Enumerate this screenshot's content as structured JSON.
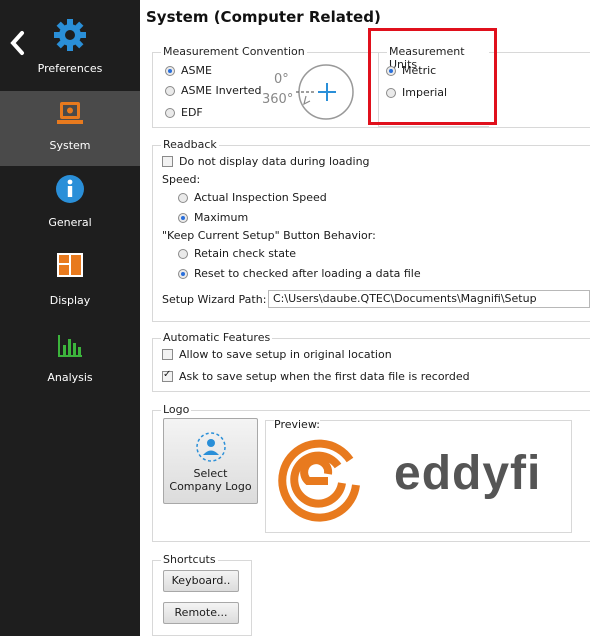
{
  "sidebar": {
    "items": [
      {
        "label": "Preferences",
        "icon": "gear-icon"
      },
      {
        "label": "System",
        "icon": "computer-icon"
      },
      {
        "label": "General",
        "icon": "info-icon"
      },
      {
        "label": "Display",
        "icon": "display-layout-icon"
      },
      {
        "label": "Analysis",
        "icon": "bar-chart-icon"
      }
    ]
  },
  "page_title": "System (Computer Related)",
  "measurement_convention": {
    "legend": "Measurement Convention",
    "options": [
      "ASME",
      "ASME Inverted",
      "EDF"
    ],
    "selected": "ASME",
    "diagram": {
      "zero": "0°",
      "three_sixty": "360°"
    }
  },
  "measurement_units": {
    "legend": "Measurement Units",
    "options": [
      "Metric",
      "Imperial"
    ],
    "selected": "Metric"
  },
  "readback": {
    "legend": "Readback",
    "no_display_label": "Do not display data during loading",
    "speed_label": "Speed:",
    "speed_options": [
      "Actual Inspection Speed",
      "Maximum"
    ],
    "speed_selected": "Maximum",
    "keep_label": "\"Keep Current Setup\" Button Behavior:",
    "keep_options": [
      "Retain check state",
      "Reset to checked after loading a data file"
    ],
    "keep_selected": "Reset to checked after loading a data file",
    "wizard_label": "Setup Wizard Path:",
    "wizard_path": "C:\\Users\\daube.QTEC\\Documents\\Magnifi\\Setup"
  },
  "automatic": {
    "legend": "Automatic Features",
    "allow_label": "Allow to save setup in original location",
    "ask_label": "Ask to save setup when the first data file is recorded"
  },
  "logo": {
    "legend": "Logo",
    "select_label_1": "Select",
    "select_label_2": "Company Logo",
    "preview_label": "Preview:",
    "brand_text": "eddyfi",
    "brand_color": "#e87a1e"
  },
  "shortcuts": {
    "legend": "Shortcuts",
    "keyboard_label": "Keyboard..",
    "remote_label": "Remote..."
  },
  "colors": {
    "accent": "#2a8fd8",
    "highlight": "#e0101c"
  }
}
